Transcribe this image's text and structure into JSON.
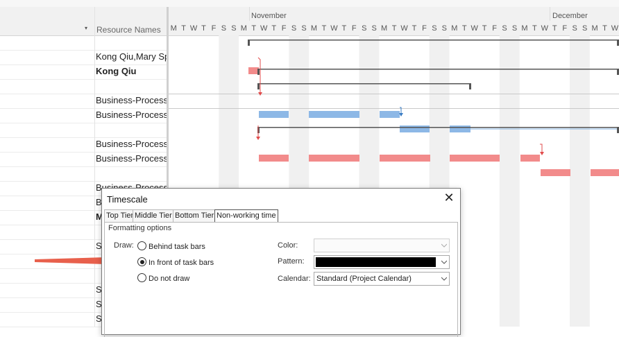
{
  "grid": {
    "dropdown_icon": "▾",
    "column_header": "Resource Names",
    "rows": [
      {
        "name": "",
        "bold": false
      },
      {
        "name": "Kong Qiu,Mary Sp",
        "bold": false
      },
      {
        "name": "Kong Qiu",
        "bold": true
      },
      {
        "name": "",
        "bold": false
      },
      {
        "name": "Business-Process-",
        "bold": false
      },
      {
        "name": "Business-Process-",
        "bold": false
      },
      {
        "name": "",
        "bold": false
      },
      {
        "name": "Business-Process-",
        "bold": false
      },
      {
        "name": "Business-Process-",
        "bold": false
      },
      {
        "name": "",
        "bold": false
      },
      {
        "name": "Business-Process-",
        "bold": false
      },
      {
        "name": "B",
        "bold": false
      },
      {
        "name": "M",
        "bold": true
      },
      {
        "name": "",
        "bold": false
      },
      {
        "name": "S",
        "bold": false
      },
      {
        "name": "",
        "bold": false
      },
      {
        "name": "",
        "bold": false
      },
      {
        "name": "S",
        "bold": false
      },
      {
        "name": "S",
        "bold": false
      },
      {
        "name": "S",
        "bold": false
      }
    ]
  },
  "timescale": {
    "months": [
      "November",
      "December"
    ],
    "day_letters": [
      "M",
      "T",
      "W",
      "T",
      "F",
      "S",
      "S",
      "M",
      "T",
      "W",
      "T",
      "F",
      "S",
      "S",
      "M",
      "T",
      "W",
      "T",
      "F",
      "S",
      "S",
      "M",
      "T",
      "W",
      "T",
      "F",
      "S",
      "S",
      "M",
      "T",
      "W",
      "T",
      "F",
      "S",
      "S",
      "M",
      "T",
      "W",
      "T",
      "F",
      "S",
      "S",
      "M",
      "T",
      "W"
    ]
  },
  "dialog": {
    "title": "Timescale",
    "close_icon": "✕",
    "tabs": [
      "Top Tier",
      "Middle Tier",
      "Bottom Tier",
      "Non-working time"
    ],
    "active_tab": "Non-working time",
    "section_label": "Formatting options",
    "draw_label": "Draw:",
    "draw_options": [
      {
        "label": "Behind task bars",
        "checked": false
      },
      {
        "label": "In front of task bars",
        "checked": true
      },
      {
        "label": "Do not draw",
        "checked": false
      }
    ],
    "color_label": "Color:",
    "color_value": "",
    "pattern_label": "Pattern:",
    "pattern_color": "#000000",
    "calendar_label": "Calendar:",
    "calendar_value": "Standard (Project Calendar)"
  },
  "colors": {
    "task_blue": "#8db8e6",
    "task_red": "#f28b8b",
    "summary": "#555555",
    "nonworking": "#f0f0f0",
    "arrow_callout": "#e8604c"
  }
}
